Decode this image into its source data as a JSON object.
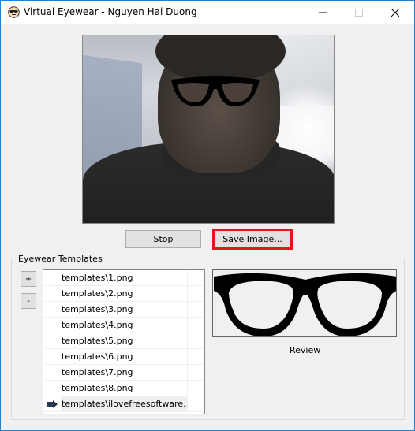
{
  "window": {
    "title": "Virtual Eyewear - Nguyen Hai Duong",
    "app_icon": "sunglasses-face-icon",
    "controls": [
      "minimize-icon",
      "maximize-icon",
      "close-icon"
    ]
  },
  "camera": {
    "description": "Live webcam feed with eyewear overlay"
  },
  "buttons": {
    "stop": "Stop",
    "save_image": "Save Image..."
  },
  "highlight_color": "#e8141d",
  "templates_group": {
    "label": "Eyewear Templates",
    "add_button": "+",
    "remove_button": "-",
    "items": [
      {
        "label": "templates\\1.png",
        "current": false
      },
      {
        "label": "templates\\2.png",
        "current": false
      },
      {
        "label": "templates\\3.png",
        "current": false
      },
      {
        "label": "templates\\4.png",
        "current": false
      },
      {
        "label": "templates\\5.png",
        "current": false
      },
      {
        "label": "templates\\6.png",
        "current": false
      },
      {
        "label": "templates\\7.png",
        "current": false
      },
      {
        "label": "templates\\8.png",
        "current": false
      },
      {
        "label": "templates\\ilovefreesoftware...",
        "current": true
      }
    ],
    "review_label": "Review"
  }
}
